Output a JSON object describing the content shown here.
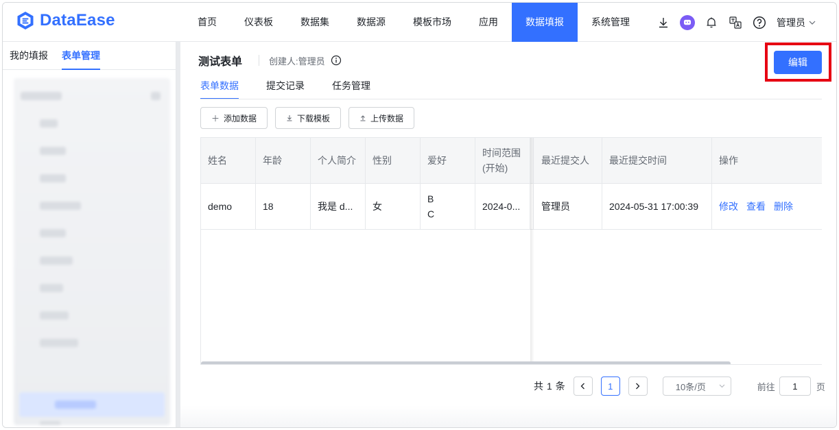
{
  "app": {
    "name": "DataEase"
  },
  "nav": {
    "items": [
      "首页",
      "仪表板",
      "数据集",
      "数据源",
      "模板市场",
      "应用",
      "数据填报",
      "系统管理"
    ],
    "active_index": 6
  },
  "header": {
    "user_label": "管理员"
  },
  "sidebar": {
    "tabs": [
      "我的填报",
      "表单管理"
    ],
    "active_tab": 1
  },
  "form": {
    "title": "测试表单",
    "creator": "创建人:管理员",
    "edit_label": "编辑"
  },
  "tabs": {
    "items": [
      "表单数据",
      "提交记录",
      "任务管理"
    ],
    "active_index": 0
  },
  "actions": {
    "add": "添加数据",
    "download": "下载模板",
    "upload": "上传数据"
  },
  "table": {
    "columns": [
      "姓名",
      "年龄",
      "个人简介",
      "性别",
      "爱好",
      "时间范围",
      "(开始)",
      "最近提交人",
      "最近提交时间",
      "操作"
    ],
    "row": {
      "name": "demo",
      "age": "18",
      "bio": "我是 d...",
      "gender": "女",
      "hobby_1": "B",
      "hobby_2": "C",
      "range_start": "2024-0...",
      "submitter": "管理员",
      "submit_time": "2024-05-31  17:00:39",
      "op_edit": "修改",
      "op_view": "查看",
      "op_delete": "删除"
    }
  },
  "pager": {
    "total_prefix": "共",
    "total": "1",
    "total_suffix": "条",
    "current_page": "1",
    "page_size": "10条/页",
    "goto_label": "前往",
    "goto_value": "1",
    "page_unit": "页"
  },
  "colors": {
    "primary": "#3370ff",
    "highlight": "#e60012"
  }
}
